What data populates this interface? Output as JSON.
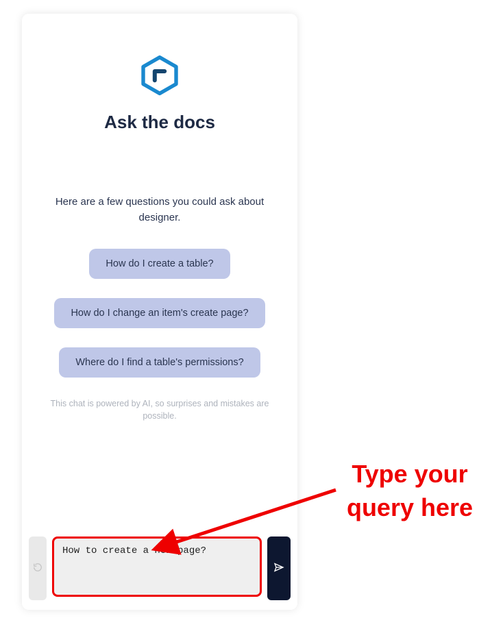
{
  "header": {
    "title": "Ask the docs"
  },
  "intro": "Here are a few questions you could ask about designer.",
  "suggestions": [
    "How do I create a table?",
    "How do I change an item's create page?",
    "Where do I find a table's permissions?"
  ],
  "disclaimer": "This chat is powered by AI, so surprises and mistakes are possible.",
  "input": {
    "value": "How to create a new page?",
    "placeholder": ""
  },
  "annotation": {
    "label": "Type your query here"
  },
  "colors": {
    "accent_red": "#ee0000",
    "chip_bg": "#bfc7e8",
    "dark_navy": "#0d1730",
    "logo_blue": "#1a89cf"
  }
}
